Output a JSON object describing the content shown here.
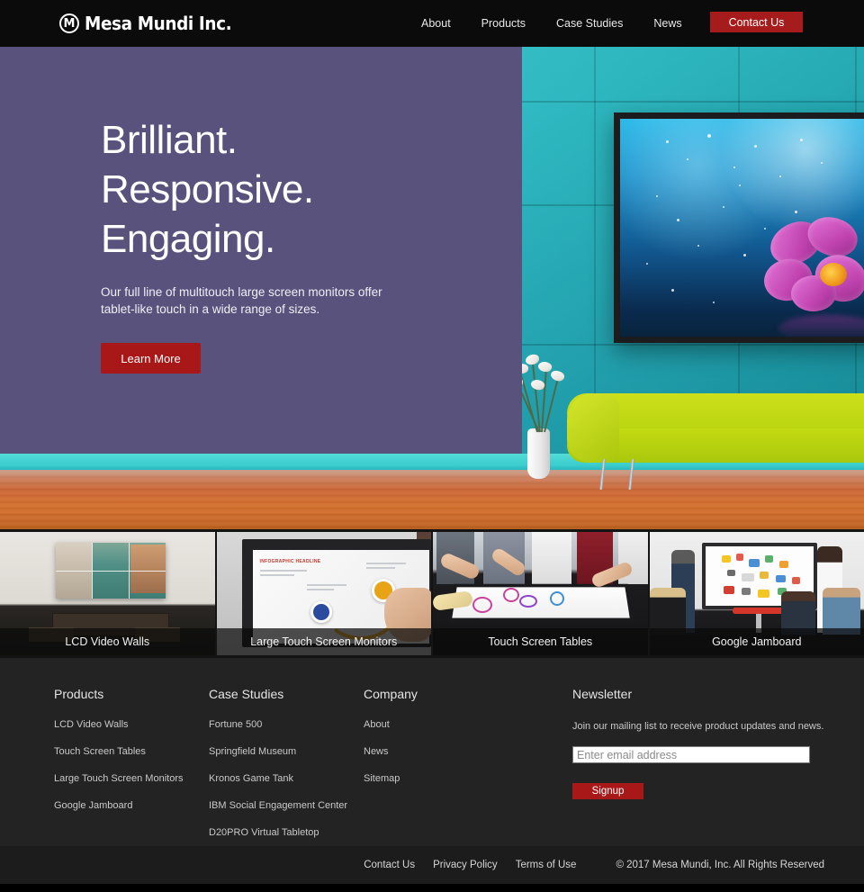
{
  "header": {
    "logo_text": "Mesa Mundi Inc.",
    "logo_emblem": "M",
    "nav": [
      {
        "label": "About"
      },
      {
        "label": "Products"
      },
      {
        "label": "Case Studies"
      },
      {
        "label": "News"
      }
    ],
    "contact_button": "Contact Us"
  },
  "hero": {
    "headline_line1": "Brilliant.",
    "headline_line2": "Responsive.",
    "headline_line3": "Engaging.",
    "subtext": "Our full line of multitouch large screen monitors offer tablet-like touch in a wide range of sizes.",
    "cta_label": "Learn More",
    "overlay_color": "#58527c",
    "cta_color": "#a81818"
  },
  "tiles": [
    {
      "caption": "LCD Video Walls"
    },
    {
      "caption": "Large Touch Screen Monitors"
    },
    {
      "caption": "Touch Screen Tables"
    },
    {
      "caption": "Google Jamboard"
    }
  ],
  "tile_art": {
    "t2_headline": "INFOGRAPHIC HEADLINE"
  },
  "footer": {
    "columns": [
      {
        "title": "Products",
        "links": [
          {
            "label": "LCD Video Walls"
          },
          {
            "label": "Touch Screen Tables"
          },
          {
            "label": "Large Touch Screen Monitors"
          },
          {
            "label": "Google Jamboard"
          }
        ]
      },
      {
        "title": "Case Studies",
        "links": [
          {
            "label": "Fortune 500"
          },
          {
            "label": "Springfield Museum"
          },
          {
            "label": "Kronos Game Tank"
          },
          {
            "label": "IBM Social Engagement Center"
          },
          {
            "label": "D20PRO Virtual Tabletop"
          }
        ]
      },
      {
        "title": "Company",
        "links": [
          {
            "label": "About"
          },
          {
            "label": "News"
          },
          {
            "label": "Sitemap"
          }
        ]
      }
    ],
    "newsletter": {
      "title": "Newsletter",
      "description": "Join our mailing list to receive product updates and news.",
      "placeholder": "Enter email address",
      "input_value": "",
      "signup_label": "Signup"
    }
  },
  "bottom_bar": {
    "links": [
      {
        "label": "Contact Us"
      },
      {
        "label": "Privacy Policy"
      },
      {
        "label": "Terms of Use"
      }
    ],
    "copyright": "© 2017 Mesa Mundi, Inc. All Rights Reserved"
  }
}
